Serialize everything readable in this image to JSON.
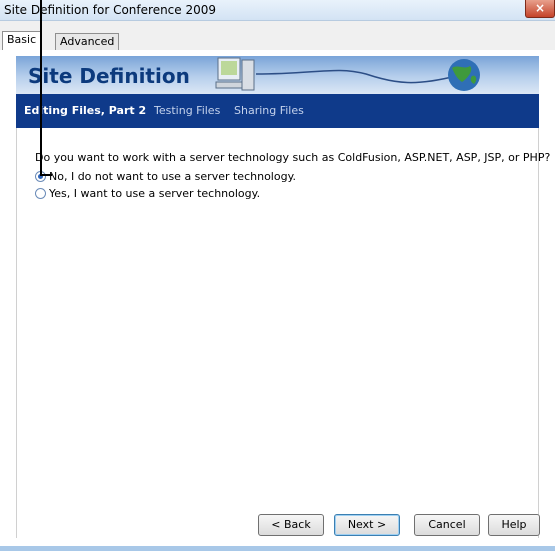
{
  "window": {
    "title": "Site Definition for Conference 2009",
    "close_glyph": "×"
  },
  "tabs": [
    {
      "label": "Basic",
      "active": true
    },
    {
      "label": "Advanced",
      "active": false
    }
  ],
  "banner": {
    "title": "Site Definition"
  },
  "nav": [
    {
      "label": "Editing Files, Part 2",
      "active": true
    },
    {
      "label": "Testing Files",
      "active": false
    },
    {
      "label": "Sharing Files",
      "active": false
    }
  ],
  "form": {
    "question": "Do you want to work with a server technology such as ColdFusion, ASP.NET, ASP, JSP, or PHP?",
    "options": [
      {
        "label": "No, I do not want to use a server technology.",
        "selected": true
      },
      {
        "label": "Yes, I want to use a server technology.",
        "selected": false
      }
    ]
  },
  "buttons": {
    "back": "< Back",
    "next": "Next >",
    "cancel": "Cancel",
    "help": "Help"
  },
  "colors": {
    "nav_background": "#0f3a8a",
    "banner_title": "#0c3a7d",
    "close_button": "#c4432a"
  }
}
